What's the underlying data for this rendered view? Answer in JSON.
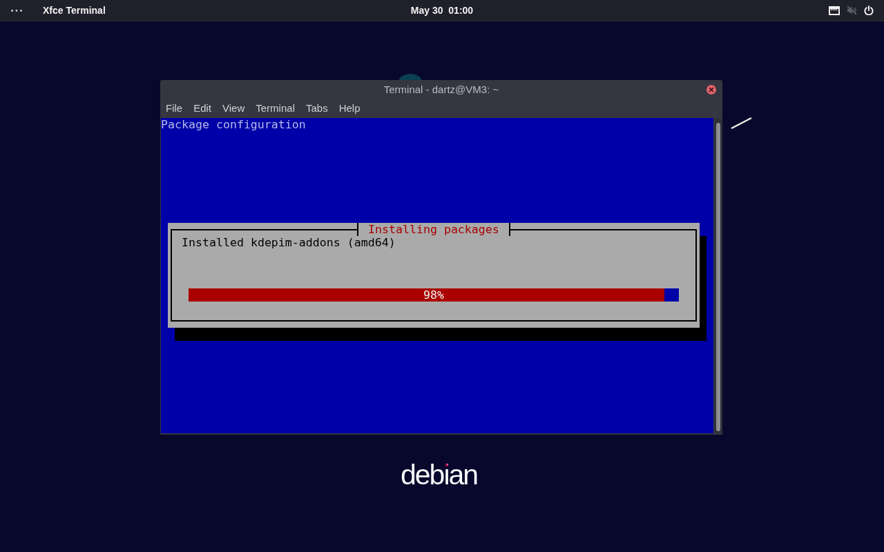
{
  "top_panel": {
    "app_title": "Xfce Terminal",
    "clock": "May 30  01:00",
    "sound": {
      "muted": true
    }
  },
  "window": {
    "title": "Terminal - dartz@VM3: ~",
    "menu": [
      "File",
      "Edit",
      "View",
      "Terminal",
      "Tabs",
      "Help"
    ],
    "terminal": {
      "backtitle": "Package configuration",
      "dialog": {
        "title": "Installing packages",
        "message": "Installed kdepim-addons (amd64)",
        "progress": {
          "level": 0.97,
          "reading": "98%"
        }
      }
    }
  },
  "desktop": {
    "logo": "debian"
  }
}
